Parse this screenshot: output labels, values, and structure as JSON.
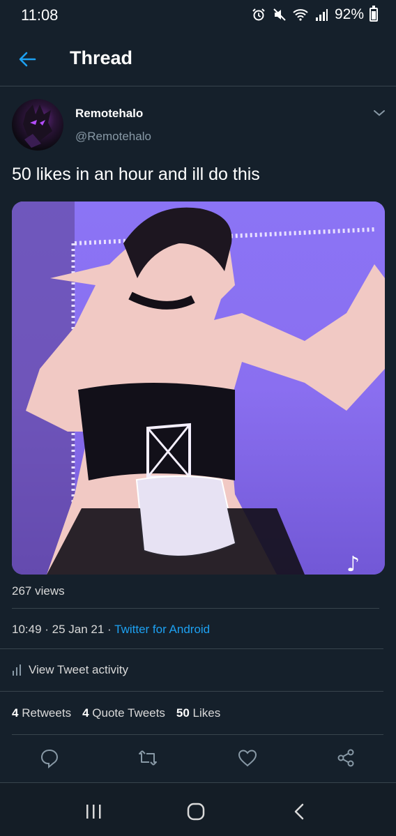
{
  "status_bar": {
    "time": "11:08",
    "battery_percent": "92%",
    "icons": [
      "alarm-icon",
      "mute-icon",
      "wifi-icon",
      "signal-icon",
      "battery-icon"
    ]
  },
  "header": {
    "title": "Thread",
    "back_icon": "arrow-left-icon"
  },
  "tweet": {
    "display_name": "Remotehalo",
    "username": "@Remotehalo",
    "text": "50 likes in an hour and ill do this",
    "media_description": "video thumbnail",
    "views": "267 views",
    "time": "10:49 · 25 Jan 21 · ",
    "source": "Twitter for Android",
    "activity_label": "View Tweet activity",
    "retweets_count": "4",
    "retweets_label": "Retweets",
    "quote_count": "4",
    "quote_label": "Quote Tweets",
    "likes_count": "50",
    "likes_label": "Likes"
  },
  "actions": [
    "reply-icon",
    "retweet-icon",
    "like-icon",
    "share-icon"
  ],
  "navbar": [
    "recent-apps-icon",
    "home-icon",
    "back-icon"
  ],
  "colors": {
    "background": "#15202b",
    "accent": "#1da1f2",
    "secondary_text": "#8899a6",
    "divider": "#38444d"
  }
}
